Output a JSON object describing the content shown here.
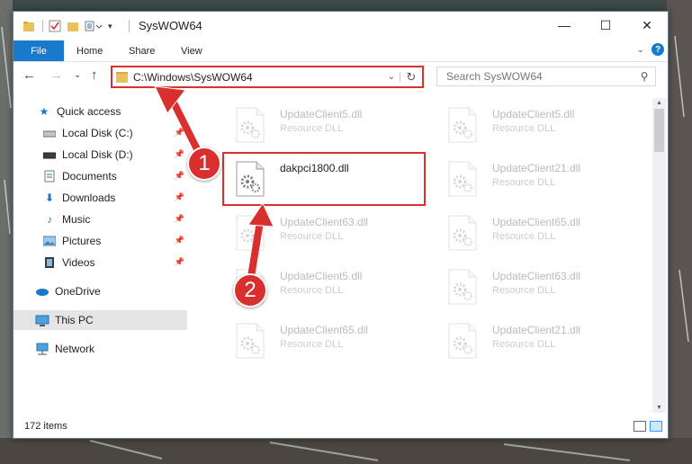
{
  "window": {
    "title": "SysWOW64",
    "controls": {
      "minimize": "—",
      "maximize": "☐",
      "close": "✕"
    }
  },
  "ribbon": {
    "tabs": [
      {
        "label": "File"
      },
      {
        "label": "Home"
      },
      {
        "label": "Share"
      },
      {
        "label": "View"
      }
    ]
  },
  "nav": {
    "address": "C:\\Windows\\SysWOW64",
    "search_placeholder": "Search SysWOW64"
  },
  "sidebar": {
    "items": [
      {
        "label": "Quick access",
        "icon": "star-icon"
      },
      {
        "label": "Local Disk (C:)",
        "icon": "drive-icon",
        "pinned": true
      },
      {
        "label": "Local Disk (D:)",
        "icon": "drive-icon",
        "pinned": true
      },
      {
        "label": "Documents",
        "icon": "documents-icon",
        "pinned": true
      },
      {
        "label": "Downloads",
        "icon": "download-icon",
        "pinned": true
      },
      {
        "label": "Music",
        "icon": "music-icon",
        "pinned": true
      },
      {
        "label": "Pictures",
        "icon": "pictures-icon",
        "pinned": true
      },
      {
        "label": "Videos",
        "icon": "videos-icon",
        "pinned": true
      },
      {
        "label": "OneDrive",
        "icon": "cloud-icon"
      },
      {
        "label": "This PC",
        "icon": "computer-icon",
        "selected": true
      },
      {
        "label": "Network",
        "icon": "network-icon"
      }
    ]
  },
  "files": [
    {
      "name": "UpdateClient5.dll",
      "type": "Resource DLL"
    },
    {
      "name": "UpdateClient5.dll",
      "type": "Resource DLL"
    },
    {
      "name": "dakpci1800.dll",
      "type": "",
      "active": true
    },
    {
      "name": "UpdateClient21.dll",
      "type": "Resource DLL"
    },
    {
      "name": "UpdateClient63.dll",
      "type": "Resource DLL"
    },
    {
      "name": "UpdateClient65.dll",
      "type": "Resource DLL"
    },
    {
      "name": "UpdateClient5.dll",
      "type": "Resource DLL"
    },
    {
      "name": "UpdateClient63.dll",
      "type": "Resource DLL"
    },
    {
      "name": "UpdateClient65.dll",
      "type": "Resource DLL"
    },
    {
      "name": "UpdateClient21.dll",
      "type": "Resource DLL"
    }
  ],
  "status": {
    "count": "172 items"
  },
  "callouts": [
    {
      "label": "1"
    },
    {
      "label": "2"
    }
  ],
  "colors": {
    "accent": "#1979ca",
    "highlight": "#d9302f",
    "selected": "#cce8ff"
  }
}
